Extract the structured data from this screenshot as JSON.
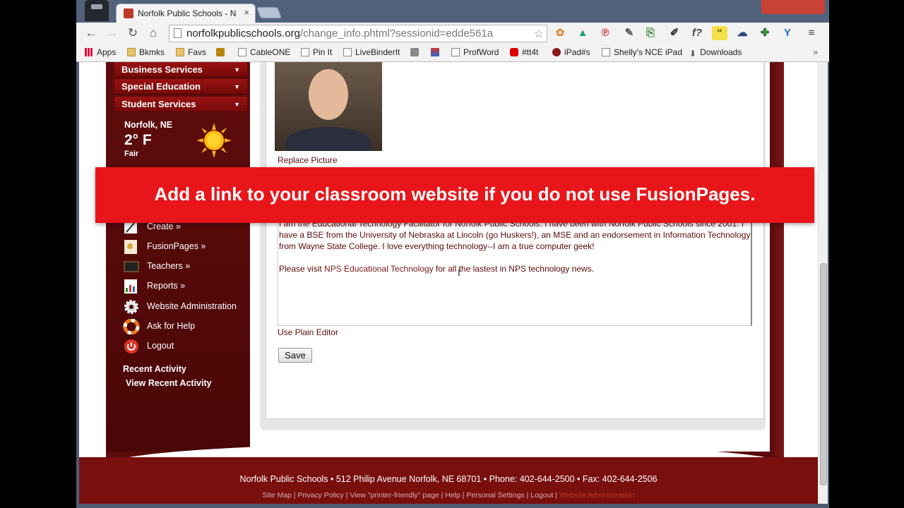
{
  "browser": {
    "tab_title": "Norfolk Public Schools - N",
    "tab_close": "×",
    "url_host": "norfolkpublicschools.org",
    "url_path": "/change_info.phtml?sessionid=edde561a",
    "bookmarks": [
      "Apps",
      "Bkmks",
      "Favs",
      "CableONE",
      "Pin It",
      "LiveBinderIt",
      "ProfWord",
      "#tt4t",
      "iPad#s",
      "Shelly's NCE iPad",
      "Downloads"
    ],
    "bookmarks_more": "»"
  },
  "sidebar": {
    "menu": [
      {
        "label": "Business Services",
        "arrow": "▼"
      },
      {
        "label": "Special Education",
        "arrow": "▼"
      },
      {
        "label": "Student Services",
        "arrow": "▼"
      }
    ],
    "weather": {
      "city": "Norfolk, NE",
      "temp": "2° F",
      "condition": "Fair"
    },
    "tools": [
      {
        "label": "Create »",
        "icon": "pencil-icon"
      },
      {
        "label": "FusionPages »",
        "icon": "pages-icon"
      },
      {
        "label": "Teachers »",
        "icon": "chalkboard-icon"
      },
      {
        "label": "Reports »",
        "icon": "report-icon"
      },
      {
        "label": "Website Administration",
        "icon": "gear-icon"
      },
      {
        "label": "Ask for Help",
        "icon": "lifebuoy-icon"
      },
      {
        "label": "Logout",
        "icon": "power-icon"
      }
    ],
    "recent_title": "Recent Activity",
    "recent_link": "View Recent Activity"
  },
  "main": {
    "replace_picture": "Replace Picture",
    "bio_paragraph": "I am the Educational Technology Facilitator for Norfolk Public Schools. I have been with Norfolk Public Schools since 2001. I have a BSE from the University of Nebraska at Lincoln (go Huskers!), an MSE and an endorsement in Information Technology from Wayne State College. I love everything technology--I am a true computer geek!",
    "visit_prefix": "Please visit ",
    "visit_link": "NPS Educational Technology",
    "visit_suffix": " for all the lastest in NPS technology news.",
    "plain_editor": "Use Plain Editor",
    "save_label": "Save"
  },
  "banner": {
    "text": "Add a link to your classroom website if you do not use FusionPages."
  },
  "footer": {
    "address": "Norfolk Public Schools • 512 Philip Avenue Norfolk, NE 68701 • Phone: 402-644-2500 • Fax: 402-644-2506",
    "links": "Site Map | Privacy Policy | View \"printer-friendly\" page | Help | Personal Settings | Logout | ",
    "admin_link": "Website Administration"
  },
  "colors": {
    "school_maroon": "#5b0b0b",
    "banner_red": "#e8161a",
    "menu_red": "#8a1010"
  }
}
